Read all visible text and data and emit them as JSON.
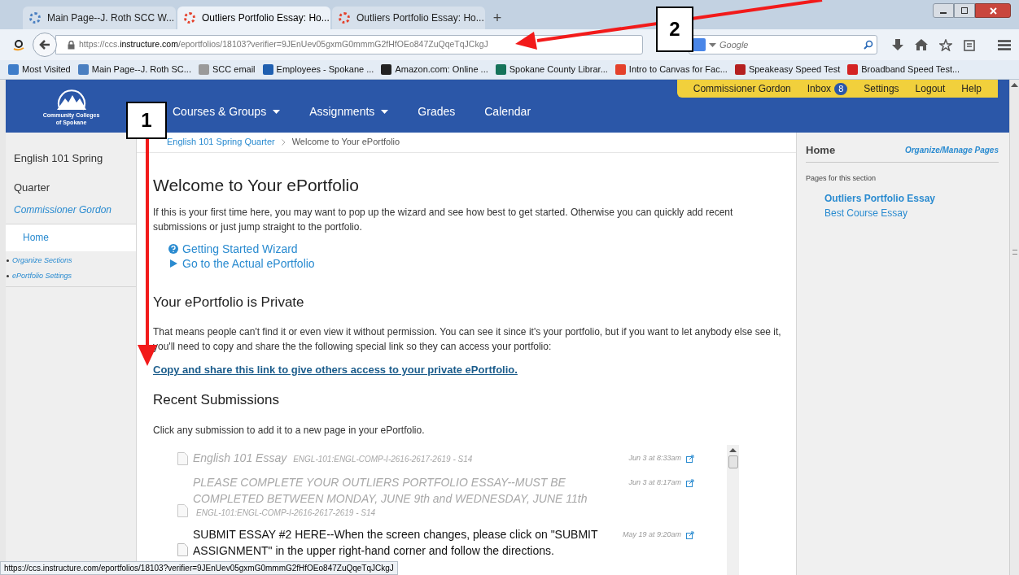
{
  "browser": {
    "tabs": [
      {
        "label": "Main Page--J. Roth SCC W...",
        "selected": false,
        "color": "#4a7fc1"
      },
      {
        "label": "Outliers Portfolio Essay: Ho...",
        "selected": true,
        "color": "#e4412b"
      },
      {
        "label": "Outliers Portfolio Essay: Ho...",
        "selected": false,
        "color": "#e4412b"
      }
    ],
    "new_tab": "+",
    "url": {
      "prefix": "https://ccs.",
      "host": "instructure.com",
      "path": "/eportfolios/18103?verifier=9JEnUev05gxmG0mmmG2fHfOEo847ZuQqeTqJCkgJ"
    },
    "search": {
      "placeholder": "Google"
    },
    "bookmarks": [
      {
        "label": "Most Visited",
        "color": "#3d7cc9"
      },
      {
        "label": "Main Page--J. Roth SC...",
        "color": "#4a7fc1"
      },
      {
        "label": "SCC email",
        "color": "#9a9a9a"
      },
      {
        "label": "Employees - Spokane ...",
        "color": "#1f5fb0"
      },
      {
        "label": "Amazon.com: Online ...",
        "color": "#222222"
      },
      {
        "label": "Spokane County Librar...",
        "color": "#16735a"
      },
      {
        "label": "Intro to Canvas for Fac...",
        "color": "#e4412b"
      },
      {
        "label": "Speakeasy Speed Test",
        "color": "#b52020"
      },
      {
        "label": "Broadband Speed Test...",
        "color": "#d42323"
      }
    ]
  },
  "header": {
    "logo": [
      "Community Colleges",
      "of Spokane"
    ],
    "nav": [
      {
        "label": "Courses & Groups",
        "has_menu": true
      },
      {
        "label": "Assignments",
        "has_menu": true
      },
      {
        "label": "Grades",
        "has_menu": false
      },
      {
        "label": "Calendar",
        "has_menu": false
      }
    ],
    "user_menu": [
      {
        "label": "Commissioner Gordon"
      },
      {
        "label": "Inbox",
        "badge": "8"
      },
      {
        "label": "Settings"
      },
      {
        "label": "Logout"
      },
      {
        "label": "Help"
      }
    ]
  },
  "left_sidebar": {
    "title": "English 101 Spring Quarter",
    "owner": "Commissioner Gordon",
    "sections": [
      {
        "label": "Home",
        "selected": true
      }
    ],
    "links": [
      "Organize Sections",
      "ePortfolio Settings"
    ]
  },
  "main": {
    "breadcrumb": [
      {
        "label": "English 101 Spring Quarter",
        "link": true
      },
      {
        "label": "Welcome to Your ePortfolio",
        "link": false
      }
    ],
    "title": "Welcome to Your ePortfolio",
    "intro": "If this is your first time here, you may want to pop up the wizard and see how best to get started. Otherwise you can quickly add recent submissions or just jump straight to the portfolio.",
    "actions": [
      {
        "kind": "help",
        "label": "Getting Started Wizard"
      },
      {
        "kind": "play",
        "label": "Go to the Actual ePortfolio"
      }
    ],
    "private_heading": "Your ePortfolio is Private",
    "private_text": "That means people can't find it or even view it without permission. You can see it since it's your portfolio, but if you want to let anybody else see it, you'll need to copy and share the the following special link so they can access your portfolio:",
    "share_link": "Copy and share this link to give others access to your private ePortfolio.",
    "recent_heading": "Recent Submissions",
    "recent_hint": "Click any submission to add it to a new page in your ePortfolio.",
    "submissions": [
      {
        "title": "English 101 Essay",
        "course": "ENGL-101:ENGL-COMP-I-2616-2617-2619 - S14",
        "date": "Jun 3 at 8:33am",
        "faded": true,
        "course_inline": true
      },
      {
        "title": "PLEASE COMPLETE YOUR OUTLIERS PORTFOLIO ESSAY--MUST BE COMPLETED BETWEEN MONDAY, JUNE 9th and WEDNESDAY, JUNE 11th",
        "course": "ENGL-101:ENGL-COMP-I-2616-2617-2619 - S14",
        "date": "Jun 3 at 8:17am",
        "faded": true,
        "course_inline": false
      },
      {
        "title": "SUBMIT ESSAY #2 HERE--When the screen changes, please click on \"SUBMIT ASSIGNMENT\" in the upper right-hand corner and follow the directions.",
        "date": "May 19 at 9:20am",
        "faded": false
      }
    ]
  },
  "right_sidebar": {
    "heading": "Home",
    "manage_link": "Organize/Manage Pages",
    "pages_label": "Pages for this section",
    "pages": [
      {
        "label": "Outliers Portfolio Essay",
        "selected": true
      },
      {
        "label": "Best Course Essay",
        "selected": false
      }
    ]
  },
  "status_bar": "https://ccs.instructure.com/eportfolios/18103?verifier=9JEnUev05gxmG0mmmG2fHfOEo847ZuQqeTqJCkgJ",
  "annotations": [
    {
      "label": "1"
    },
    {
      "label": "2"
    }
  ]
}
